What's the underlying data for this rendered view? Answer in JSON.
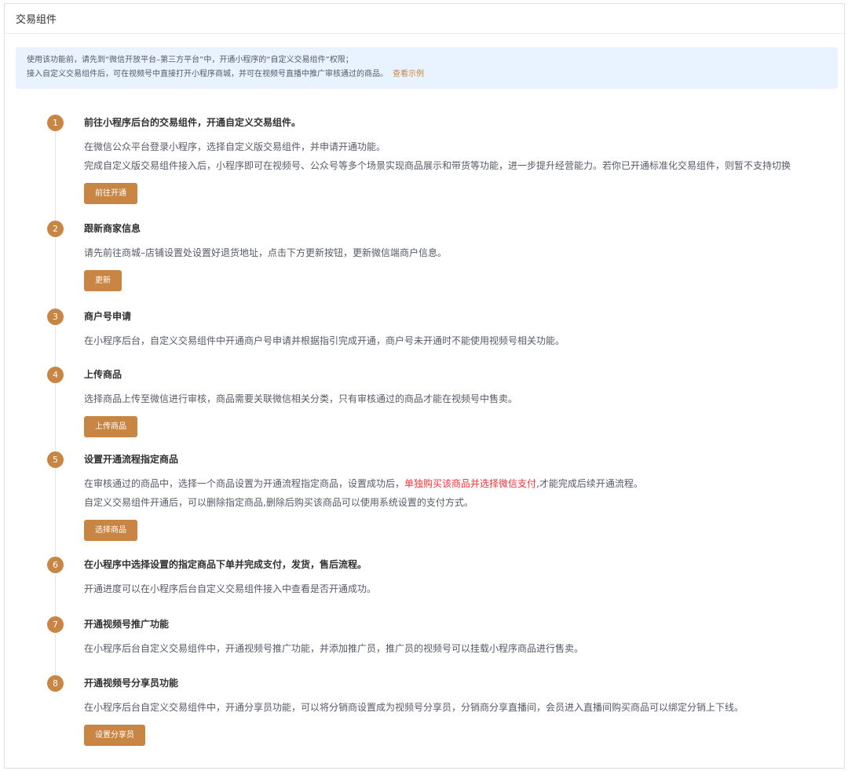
{
  "header": {
    "title": "交易组件"
  },
  "notice": {
    "line1": "使用该功能前，请先到“微信开放平台–第三方平台”中，开通小程序的“自定义交易组件”权限；",
    "line2": "接入自定义交易组件后，可在视频号中直接打开小程序商城，并可在视频号直播中推广审核通过的商品。",
    "link": "查看示例"
  },
  "steps": [
    {
      "num": "1",
      "title": "前往小程序后台的交易组件，开通自定义交易组件。",
      "desc1": "在微信公众平台登录小程序，选择自定义版交易组件，并申请开通功能。",
      "desc2": "完成自定义版交易组件接入后，小程序即可在视频号、公众号等多个场景实现商品展示和带货等功能，进一步提升经营能力。若你已开通标准化交易组件，则暂不支持切换",
      "button": "前往开通"
    },
    {
      "num": "2",
      "title": "跟新商家信息",
      "desc1": "请先前往商城–店铺设置处设置好退货地址，点击下方更新按钮，更新微信端商户信息。",
      "button": "更新"
    },
    {
      "num": "3",
      "title": "商户号申请",
      "desc1": "在小程序后台，自定义交易组件中开通商户号申请并根据指引完成开通，商户号未开通时不能使用视频号相关功能。"
    },
    {
      "num": "4",
      "title": "上传商品",
      "desc1": "选择商品上传至微信进行审核，商品需要关联微信相关分类，只有审核通过的商品才能在视频号中售卖。",
      "button": "上传商品"
    },
    {
      "num": "5",
      "title": "设置开通流程指定商品",
      "desc1_a": "在审核通过的商品中，选择一个商品设置为开通流程指定商品，设置成功后，",
      "desc1_red": "单独购买该商品并选择微信支付",
      "desc1_b": ",才能完成后续开通流程。",
      "desc2": "自定义交易组件开通后，可以删除指定商品,删除后购买该商品可以使用系统设置的支付方式。",
      "button": "选择商品"
    },
    {
      "num": "6",
      "title": "在小程序中选择设置的指定商品下单并完成支付，发货，售后流程。",
      "desc1": "开通进度可以在小程序后台自定义交易组件接入中查看是否开通成功。"
    },
    {
      "num": "7",
      "title": "开通视频号推广功能",
      "desc1": "在小程序后台自定义交易组件中，开通视频号推广功能，并添加推广员，推广员的视频号可以挂载小程序商品进行售卖。"
    },
    {
      "num": "8",
      "title": "开通视频号分享员功能",
      "desc1": "在小程序后台自定义交易组件中，开通分享员功能，可以将分销商设置成为视频号分享员，分销商分享直播间，会员进入直播间购买商品可以绑定分销上下线。",
      "button": "设置分享员"
    }
  ],
  "colors": {
    "accent": "#c98543",
    "notice_bg": "#e8f3ff",
    "highlight": "#f0343a"
  }
}
